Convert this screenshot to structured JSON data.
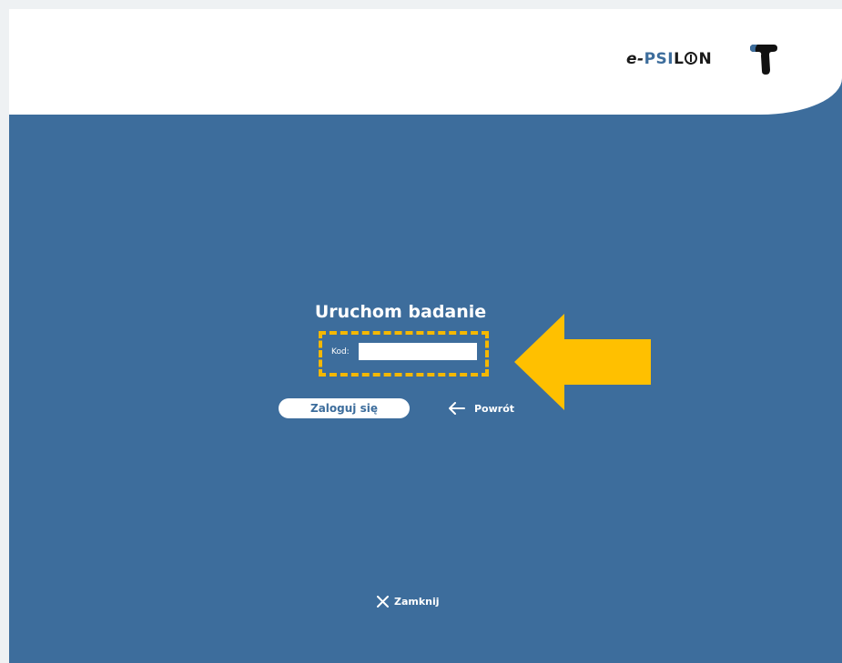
{
  "header": {
    "logo": {
      "prefix": "e-",
      "psi": "PSI",
      "l": "L",
      "n": "N",
      "mark_icon": "t-logo-mark"
    }
  },
  "login": {
    "title": "Uruchom badanie",
    "code_label": "Kod:",
    "code_value": "",
    "login_button": "Zaloguj się",
    "back_link": "Powrót",
    "back_icon": "arrow-left-icon"
  },
  "footer": {
    "close_link": "Zamknij",
    "close_icon": "close-icon"
  },
  "annotations": {
    "highlight_color": "#f5b800",
    "arrow_icon": "arrow-left-icon"
  },
  "colors": {
    "background": "#3d6d9c",
    "header": "#ffffff",
    "text": "#ffffff"
  }
}
